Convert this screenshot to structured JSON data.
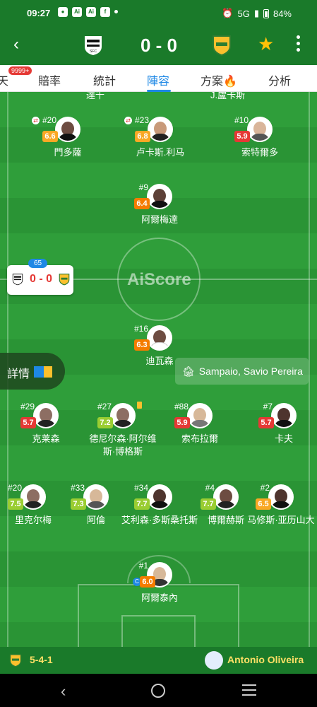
{
  "status_bar": {
    "time": "09:27",
    "network": "5G",
    "battery": "84%"
  },
  "header": {
    "score": "0 - 0"
  },
  "tabs": [
    {
      "label": "天",
      "badge": "9999+"
    },
    {
      "label": "賠率"
    },
    {
      "label": "統計"
    },
    {
      "label": "陣容",
      "active": true
    },
    {
      "label": "方案"
    },
    {
      "label": "分析"
    }
  ],
  "partial_names": [
    "達千",
    "J.盧卡斯"
  ],
  "mini_score": {
    "minute": "65",
    "score": "0 - 0"
  },
  "details": {
    "label": "詳情"
  },
  "watermark": "AiScore",
  "referee": {
    "name": "Sampaio, Savio Pereira"
  },
  "players": [
    {
      "number": "#20",
      "rating": "6.6",
      "name": "門多薩",
      "sub": true
    },
    {
      "number": "#23",
      "rating": "6.8",
      "name": "卢卡斯.利马",
      "sub": true
    },
    {
      "number": "#10",
      "rating": "5.9",
      "name": "索特爾多"
    },
    {
      "number": "#9",
      "rating": "6.4",
      "name": "阿爾梅達"
    },
    {
      "number": "#16",
      "rating": "6.3",
      "name": "迪瓦森"
    },
    {
      "number": "#29",
      "rating": "5.7",
      "name": "克莱森"
    },
    {
      "number": "#27",
      "rating": "7.2",
      "name": "德尼尔森·阿尔维斯·博格斯",
      "card": true
    },
    {
      "number": "#88",
      "rating": "5.9",
      "name": "索布拉爾"
    },
    {
      "number": "#7",
      "rating": "5.7",
      "name": "卡夫"
    },
    {
      "number": "#20",
      "rating": "7.5",
      "name": "里克尔梅"
    },
    {
      "number": "#33",
      "rating": "7.3",
      "name": "阿倫"
    },
    {
      "number": "#34",
      "rating": "7.7",
      "name": "艾利森·多斯桑托斯"
    },
    {
      "number": "#4",
      "rating": "7.7",
      "name": "博爾赫斯"
    },
    {
      "number": "#2",
      "rating": "6.5",
      "name": "马修斯·亚历山大"
    },
    {
      "number": "#1",
      "rating": "6.0",
      "name": "阿爾泰內",
      "captain": "C"
    }
  ],
  "bottom": {
    "formation": "5-4-1",
    "coach": "Antonio Oliveira"
  },
  "colors": {
    "rating_red": "#e53935",
    "rating_orange": "#f57c00",
    "rating_yellow": "#f9a825",
    "rating_green": "#9acd32",
    "accent_blue": "#1e88e5",
    "brand_green": "#1a7a2a"
  }
}
